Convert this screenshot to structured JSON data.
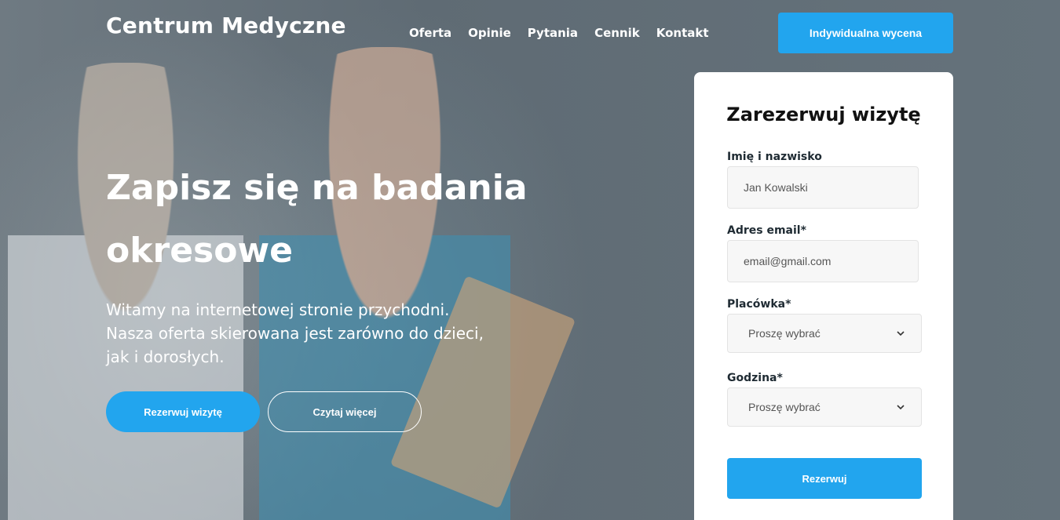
{
  "header": {
    "logo": "Centrum Medyczne",
    "nav": [
      "Oferta",
      "Opinie",
      "Pytania",
      "Cennik",
      "Kontakt"
    ],
    "cta": "Indywidualna wycena"
  },
  "hero": {
    "headline": "Zapisz się na badania okresowe",
    "intro": "Witamy na internetowej stronie przychodni. Nasza oferta skierowana jest zarówno do dzieci, jak i dorosłych.",
    "primary_button": "Rezerwuj wizytę",
    "secondary_button": "Czytaj więcej"
  },
  "form": {
    "title": "Zarezerwuj wizytę",
    "name_label": "Imię i nazwisko",
    "name_placeholder": "Jan Kowalski",
    "email_label": "Adres email*",
    "email_placeholder": "email@gmail.com",
    "clinic_label": "Placówka*",
    "clinic_value": "Proszę wybrać",
    "time_label": "Godzina*",
    "time_value": "Proszę wybrać",
    "submit": "Rezerwuj"
  },
  "colors": {
    "accent": "#22a5ee"
  }
}
